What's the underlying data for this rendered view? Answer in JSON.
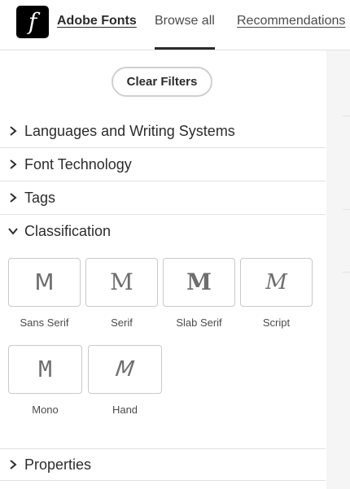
{
  "header": {
    "logo_letter": "f",
    "brand": "Adobe Fonts",
    "tabs": [
      {
        "label": "Browse all",
        "active": true
      },
      {
        "label": "Recommendations",
        "active": false
      }
    ]
  },
  "filters": {
    "clear_label": "Clear Filters",
    "sections": [
      {
        "label": "Languages and Writing Systems",
        "expanded": false
      },
      {
        "label": "Font Technology",
        "expanded": false
      },
      {
        "label": "Tags",
        "expanded": false
      },
      {
        "label": "Classification",
        "expanded": true
      },
      {
        "label": "Properties",
        "expanded": false
      }
    ],
    "classification": [
      {
        "glyph": "M",
        "label": "Sans Serif"
      },
      {
        "glyph": "M",
        "label": "Serif"
      },
      {
        "glyph": "M",
        "label": "Slab Serif"
      },
      {
        "glyph": "M",
        "label": "Script"
      },
      {
        "glyph": "M",
        "label": "Mono"
      },
      {
        "glyph": "M",
        "label": "Hand"
      }
    ]
  },
  "colors": {
    "accent": "#2c2c2c",
    "border": "#c9c9c9",
    "right_pane": "#f5f5f5"
  },
  "icons": {
    "collapsed": "chevron-right-icon",
    "expanded": "chevron-down-icon"
  }
}
